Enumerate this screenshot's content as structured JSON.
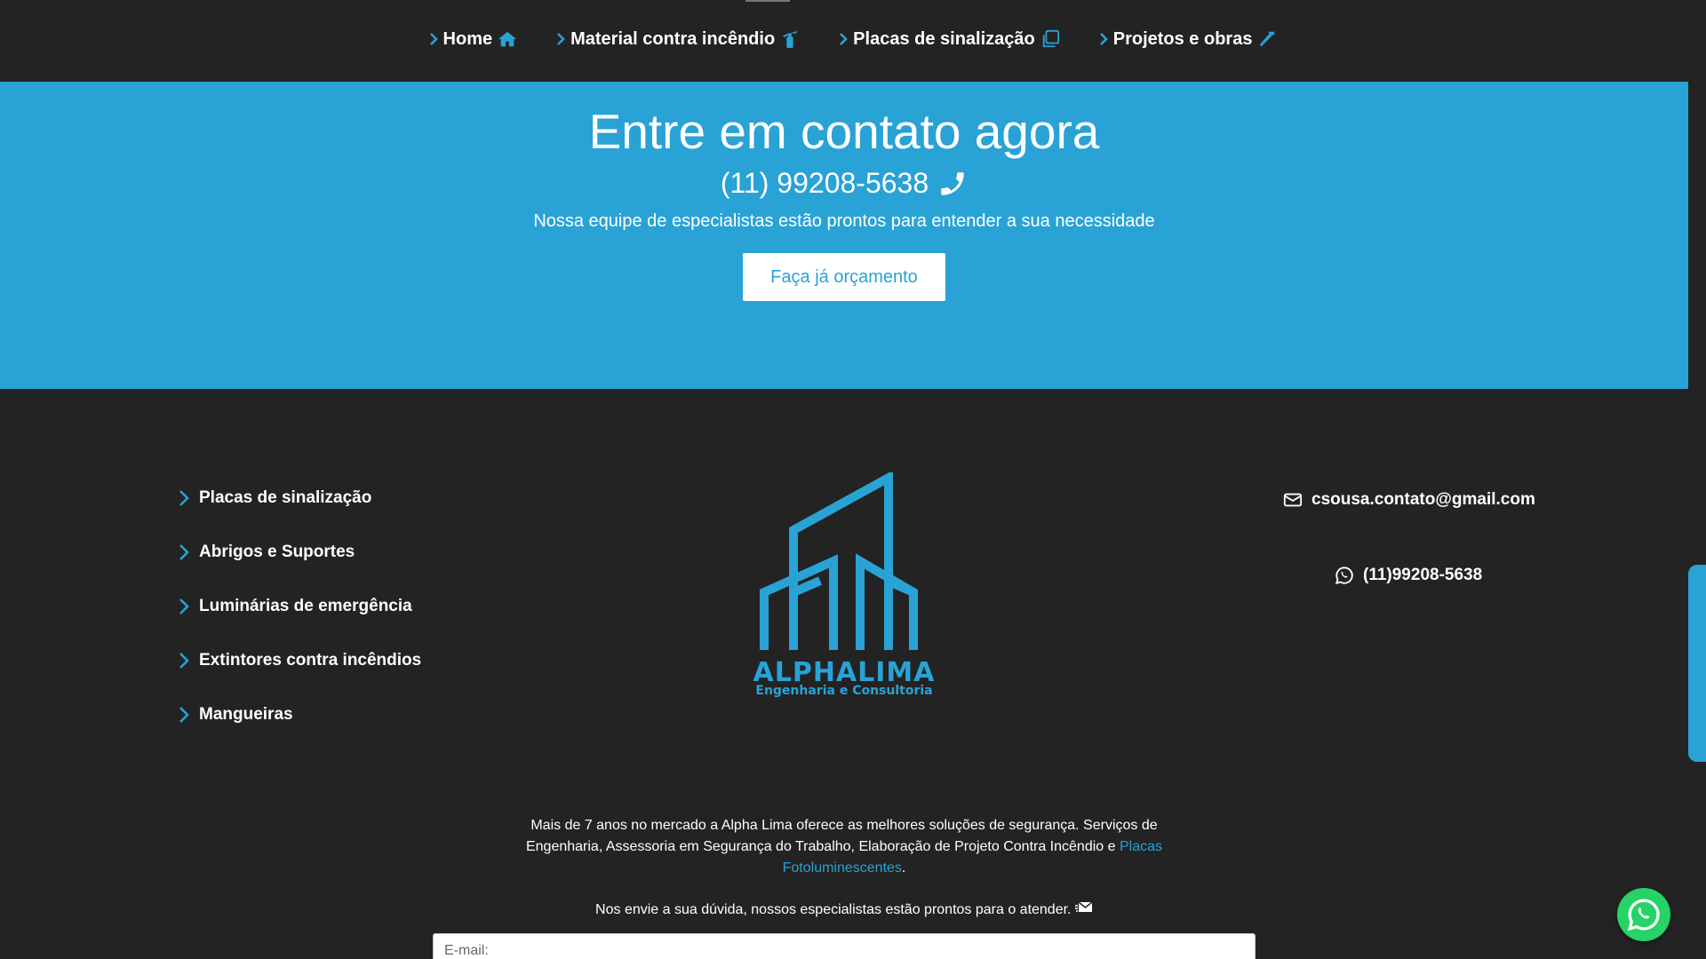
{
  "nav": {
    "items": [
      {
        "label": "Home",
        "icon": "home-icon"
      },
      {
        "label": "Material contra incêndio",
        "icon": "fire-extinguisher-icon"
      },
      {
        "label": "Placas de sinalização",
        "icon": "clone-icon"
      },
      {
        "label": "Projetos e obras",
        "icon": "hammer-icon"
      }
    ]
  },
  "contact": {
    "title": "Entre em contato agora",
    "phone": "(11) 99208-5638",
    "subtitle": "Nossa equipe de especialistas estão prontos para entender a sua necessidade",
    "cta_label": "Faça já orçamento"
  },
  "footer": {
    "links": [
      "Placas de sinalização",
      "Abrigos e Suportes",
      "Luminárias de emergência",
      "Extintores contra incêndios",
      "Mangueiras"
    ],
    "logo": {
      "name": "ALPHALIMA",
      "tagline": "Engenharia e Consultoria"
    },
    "email": "csousa.contato@gmail.com",
    "whatsapp": "(11)99208-5638",
    "about_text": "Mais de 7 anos no mercado a Alpha Lima oferece as melhores soluções de segurança. Serviços de Engenharia, Assessoria em Segurança do Trabalho, Elaboração de Projeto Contra Incêndio e ",
    "about_link": "Placas Fotoluminescentes",
    "about_end": ".",
    "send_msg": "Nos envie a sua dúvida, nossos especialistas estão prontos para o atender.",
    "email_placeholder": "E-mail:"
  },
  "colors": {
    "accent": "#29a2d6",
    "background": "#232323",
    "whatsapp": "#25d366"
  }
}
